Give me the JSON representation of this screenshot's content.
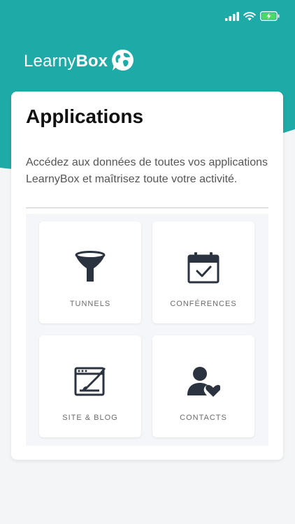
{
  "brand": {
    "name_light": "Learny",
    "name_bold": "Box"
  },
  "card": {
    "title": "Applications",
    "description": "Accédez aux données de toutes vos applications LearnyBox et maîtrisez toute votre activité."
  },
  "tiles": [
    {
      "label": "TUNNELS",
      "icon": "funnel-icon"
    },
    {
      "label": "CONFÉRENCES",
      "icon": "calendar-check-icon"
    },
    {
      "label": "SITE & BLOG",
      "icon": "website-edit-icon"
    },
    {
      "label": "CONTACTS",
      "icon": "user-heart-icon"
    }
  ],
  "colors": {
    "accent": "#1eaaa7",
    "icon": "#2b3340",
    "battery": "#4cd964"
  }
}
